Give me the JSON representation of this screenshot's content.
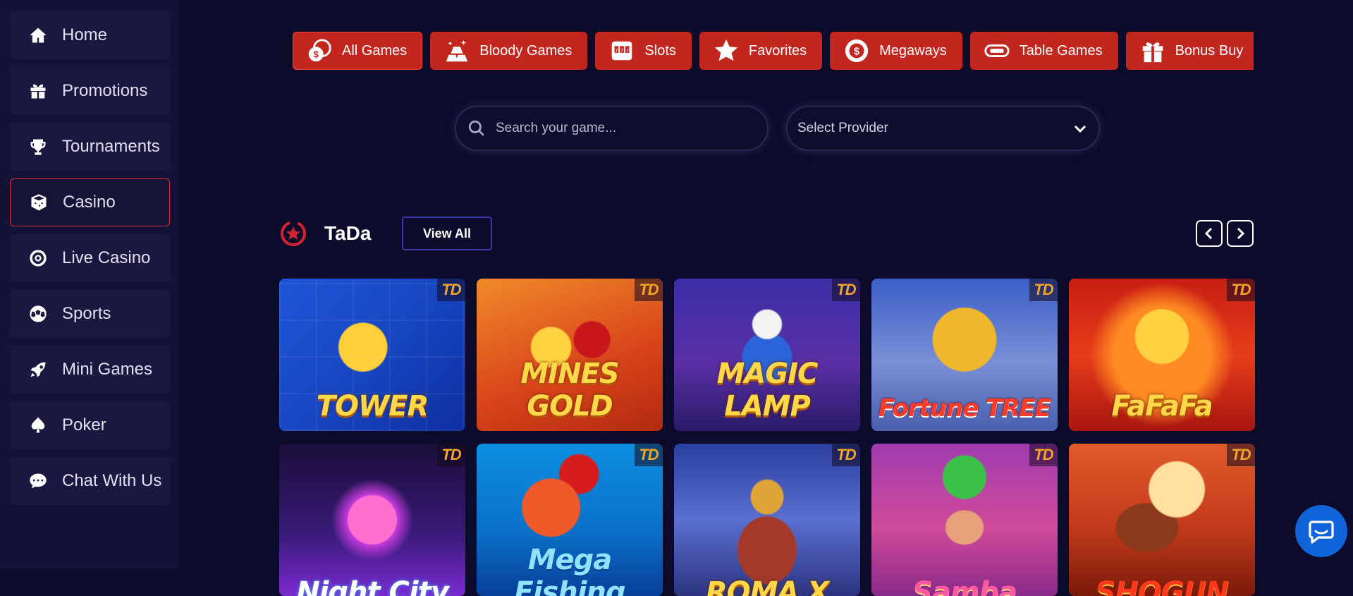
{
  "sidebar": {
    "items": [
      {
        "label": "Home",
        "icon": "home-icon"
      },
      {
        "label": "Promotions",
        "icon": "gift-icon"
      },
      {
        "label": "Tournaments",
        "icon": "trophy-icon"
      },
      {
        "label": "Casino",
        "icon": "dice-icon",
        "active": true
      },
      {
        "label": "Live Casino",
        "icon": "roulette-icon"
      },
      {
        "label": "Sports",
        "icon": "soccer-ball-icon"
      },
      {
        "label": "Mini Games",
        "icon": "rocket-icon"
      },
      {
        "label": "Poker",
        "icon": "spade-icon"
      },
      {
        "label": "Chat With Us",
        "icon": "chat-icon"
      }
    ]
  },
  "categories": [
    {
      "label": "All Games",
      "icon": "coin-stack-icon",
      "active": true
    },
    {
      "label": "Bloody Games",
      "icon": "gold-bars-icon"
    },
    {
      "label": "Slots",
      "icon": "slot-machine-icon"
    },
    {
      "label": "Favorites",
      "icon": "star-icon"
    },
    {
      "label": "Megaways",
      "icon": "dollar-chip-icon"
    },
    {
      "label": "Table Games",
      "icon": "table-chip-icon"
    },
    {
      "label": "Bonus Buy",
      "icon": "gift-box-icon"
    }
  ],
  "search": {
    "placeholder": "Search your game..."
  },
  "provider_select": {
    "label": "Select Provider"
  },
  "section": {
    "title": "TaDa",
    "view_all": "View All"
  },
  "games": [
    {
      "title": "TOWER",
      "tag": "TD"
    },
    {
      "title": "MINES GOLD",
      "tag": "TD"
    },
    {
      "title": "MAGIC LAMP",
      "tag": "TD"
    },
    {
      "title": "Fortune TREE",
      "tag": "TD"
    },
    {
      "title": "FaFaFa",
      "tag": "TD"
    },
    {
      "title": "Night City",
      "tag": "TD"
    },
    {
      "title": "Mega Fishing",
      "tag": "TD"
    },
    {
      "title": "ROMA X",
      "tag": "TD"
    },
    {
      "title": "Samba",
      "tag": "TD"
    },
    {
      "title": "SHOGUN",
      "tag": "TD"
    }
  ],
  "colors": {
    "background": "#0d0b2b",
    "sidebar": "#141236",
    "accent_red": "#c3261f",
    "active_border": "#e12b3a",
    "chat": "#0f64d9"
  }
}
